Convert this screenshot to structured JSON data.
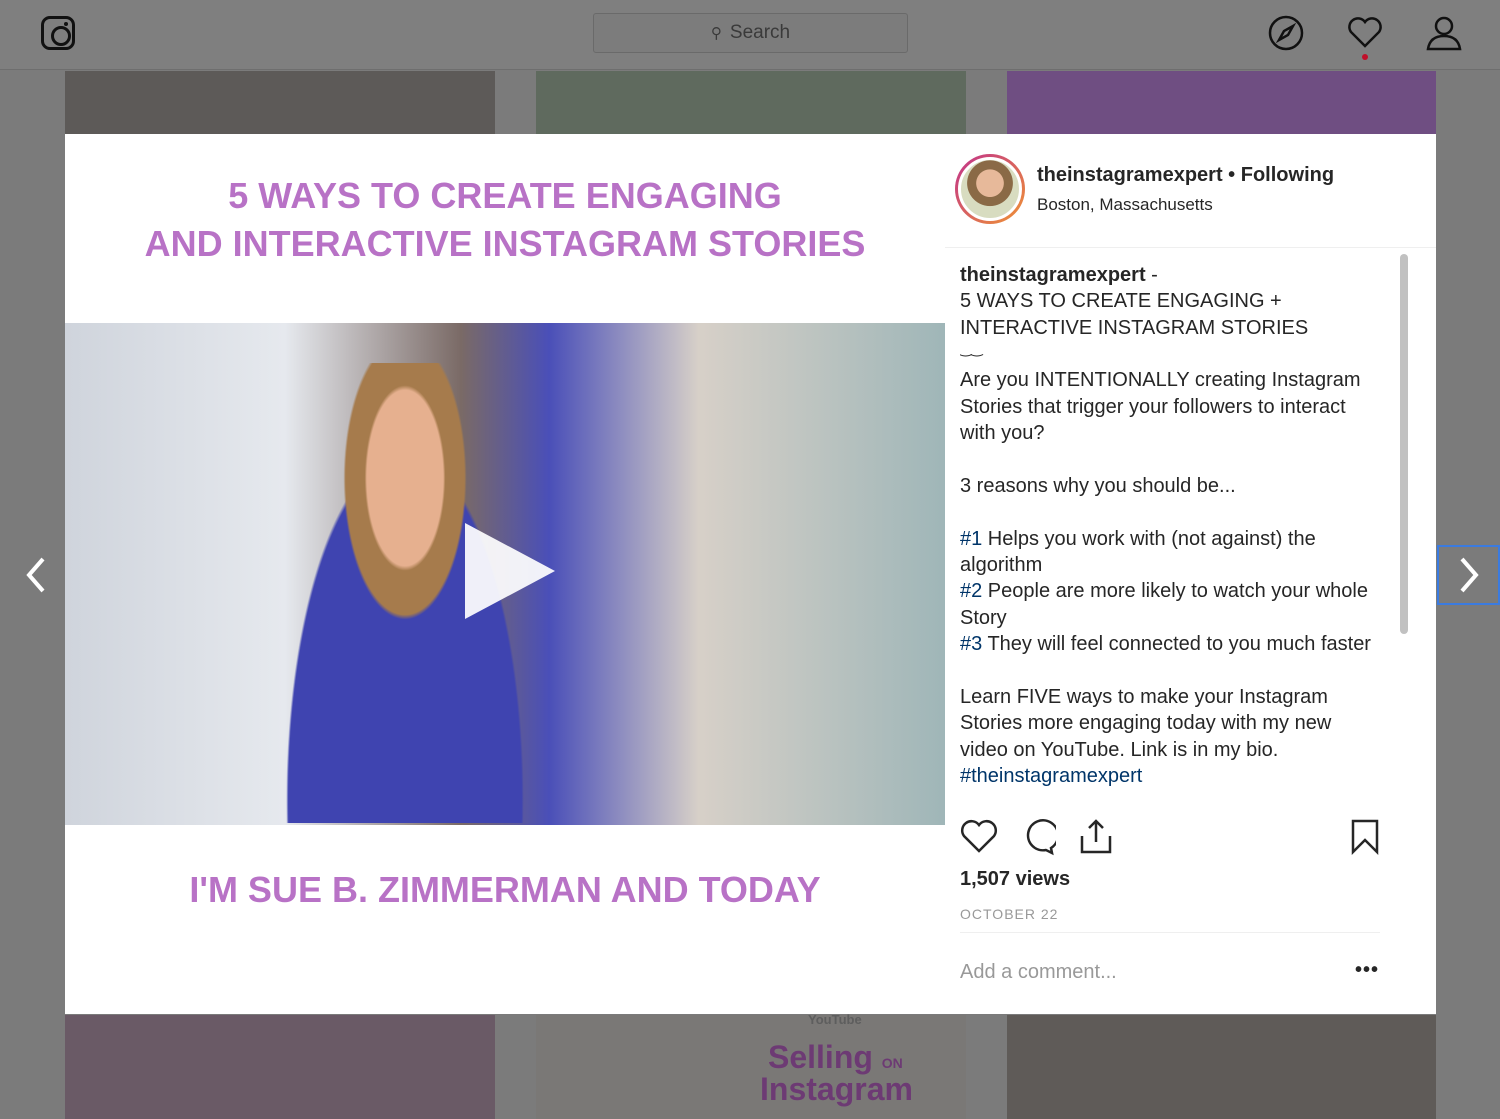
{
  "topbar": {
    "search_placeholder": "Search",
    "icons": [
      "instagram-logo",
      "explore-compass-icon",
      "activity-heart-icon",
      "profile-icon"
    ]
  },
  "post": {
    "image_title_line1": "5 WAYS TO CREATE ENGAGING",
    "image_title_line2": "AND INTERACTIVE INSTAGRAM STORIES",
    "image_subtitle": "I'M SUE B. ZIMMERMAN AND TODAY",
    "username": "theinstagramexpert",
    "follow_status": "Following",
    "location": "Boston, Massachusetts",
    "caption": {
      "author": "theinstagramexpert",
      "title_line1": "5 WAYS TO CREATE ENGAGING +",
      "title_line2": "INTERACTIVE INSTAGRAM STORIES",
      "para1": "Are you INTENTIONALLY creating Instagram Stories that trigger your followers to interact with you?",
      "para2": "3 reasons why you should be...",
      "reasons": [
        {
          "num": "#1",
          "text": " Helps you work with (not against) the algorithm"
        },
        {
          "num": "#2",
          "text": " People are more likely to watch your whole Story"
        },
        {
          "num": "#3",
          "text": " They will feel connected to you much faster"
        }
      ],
      "para3": "Learn FIVE ways to make your Instagram Stories more engaging today with my new video on YouTube. Link is in my bio.",
      "hashtag": "#theinstagramexpert"
    },
    "views": "1,507 views",
    "date": "OCTOBER 22",
    "comment_placeholder": "Add a comment...",
    "more": "•••"
  },
  "background_tiles": {
    "selling_line1": "Selling",
    "selling_on": "ON",
    "selling_line2": "Instagram",
    "youtube": "YouTube"
  },
  "colors": {
    "accent_purple": "#b872c6",
    "hashtag": "#003569",
    "nav_focus": "#3b7be0"
  }
}
